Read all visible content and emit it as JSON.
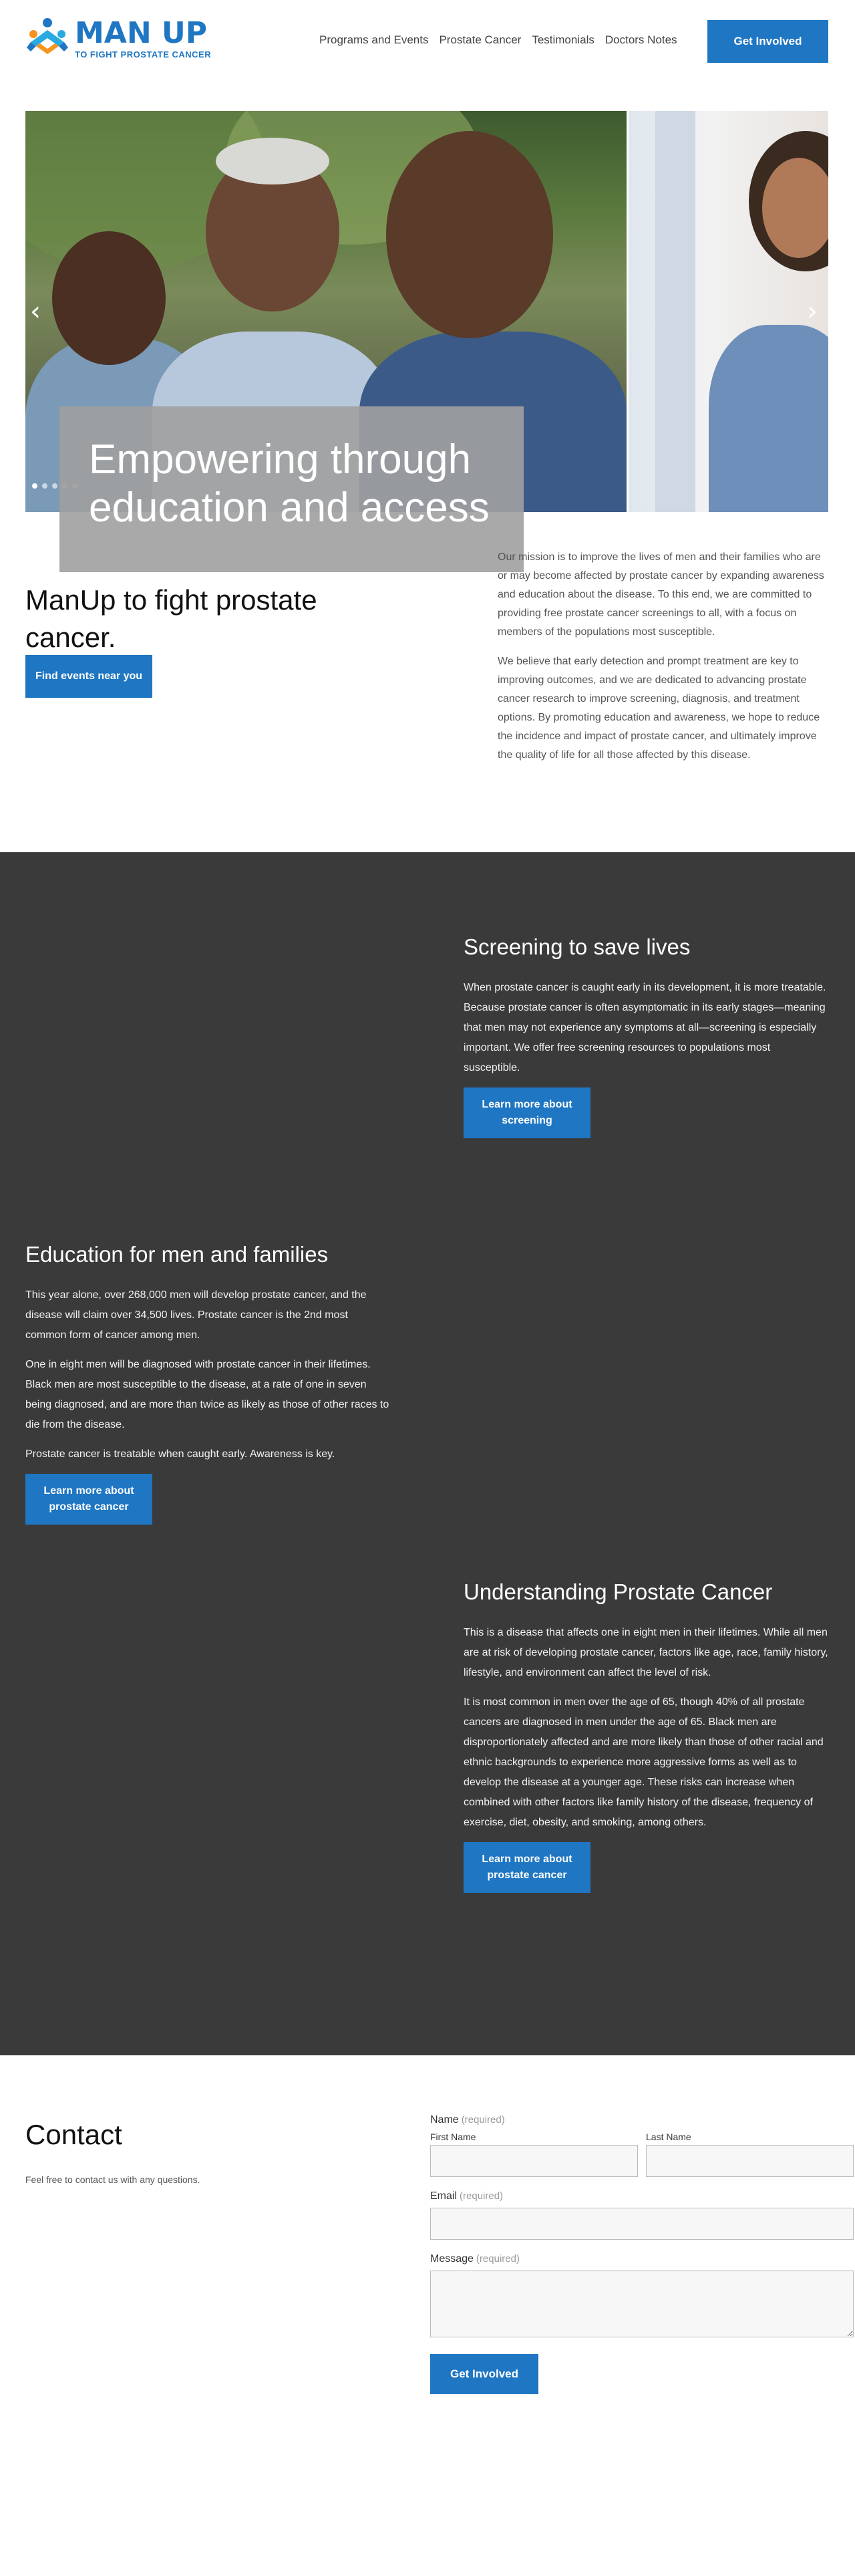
{
  "header": {
    "logo": {
      "title": "MAN UP",
      "subtitle": "TO FIGHT PROSTATE CANCER"
    },
    "nav": [
      "Programs and Events",
      "Prostate Cancer",
      "Testimonials",
      "Doctors Notes"
    ],
    "cta": "Get Involved"
  },
  "hero": {
    "caption": "Empowering through education and access",
    "prev_icon": "chevron-left-icon",
    "next_icon": "chevron-right-icon"
  },
  "mission": {
    "heading": "ManUp to fight prostate cancer.",
    "button": "Find events near you",
    "paragraphs": [
      "Our mission is to improve the lives of men and their families who are or may become affected by prostate cancer by expanding awareness and education about the disease. To this end, we are committed to providing free prostate cancer screenings to all, with a focus on members of the populations most susceptible.",
      "We believe that early detection and prompt treatment are key to improving outcomes, and we are dedicated to advancing prostate cancer research to improve screening, diagnosis, and treatment options. By promoting education and awareness, we hope to reduce the incidence and impact of prostate cancer, and ultimately improve the quality of life for all those affected by this disease."
    ]
  },
  "screening": {
    "heading": "Screening to save lives",
    "paragraph": "When prostate cancer is caught early in its development, it is more treatable. Because prostate cancer is often asymptomatic in its early stages—meaning that men may not experience any symptoms at all—screening is especially important. We offer free screening resources to populations most susceptible.",
    "button": "Learn more about screening"
  },
  "education": {
    "heading": "Education for men and families",
    "paragraphs": [
      "This year alone, over 268,000 men will develop prostate cancer, and the disease will claim over 34,500 lives. Prostate cancer is the 2nd most common form of cancer among men.",
      "One in eight men will be diagnosed with prostate cancer in their lifetimes. Black men are most susceptible to the disease, at a rate of one in seven being diagnosed, and are more than twice as likely as those of other races to die from the disease.",
      "Prostate cancer is treatable when caught early. Awareness is key."
    ],
    "button": "Learn more about prostate cancer"
  },
  "understanding": {
    "heading": "Understanding Prostate Cancer",
    "paragraphs": [
      "This is a disease that affects one in eight men in their lifetimes. While all men are at risk of developing prostate cancer, factors like age, race, family history, lifestyle, and environment can affect the level of risk.",
      "It is most common in men over the age of 65, though 40% of all prostate cancers are diagnosed in men under the age of 65. Black men are disproportionately affected and are more likely than those of other racial and ethnic backgrounds to experience more aggressive forms as well as to develop the disease at a younger age. These risks can increase when combined with other factors like family history of the disease, frequency of exercise, diet, obesity, and smoking, among others."
    ],
    "button": "Learn more about prostate cancer"
  },
  "contact": {
    "heading": "Contact",
    "intro": "Feel free to contact us with any questions.",
    "name_label": "Name",
    "required": "(required)",
    "first_name": "First Name",
    "last_name": "Last Name",
    "email_label": "Email",
    "message_label": "Message",
    "submit": "Get Involved"
  }
}
